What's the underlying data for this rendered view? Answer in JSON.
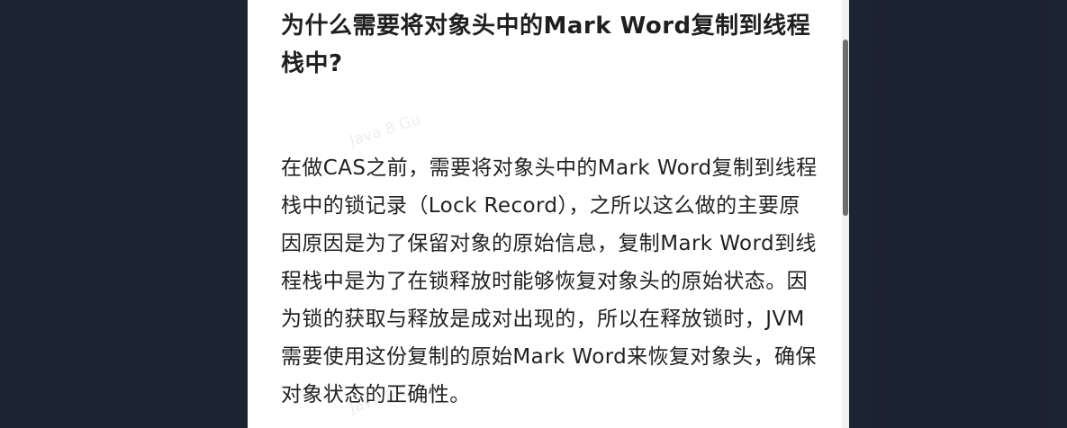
{
  "article": {
    "heading": "为什么需要将对象头中的Mark Word复制到线程栈中?",
    "body": "在做CAS之前，需要将对象头中的Mark Word复制到线程栈中的锁记录（Lock Record），之所以这么做的主要原因原因是为了保留对象的原始信息，复制Mark Word到线程栈中是为了在锁释放时能够恢复对象头的原始状态。因为锁的获取与释放是成对出现的，所以在释放锁时，JVM需要使用这份复制的原始Mark Word来恢复对象头，确保对象状态的正确性。",
    "watermark": "Java 8 Gu"
  },
  "colors": {
    "background": "#1c2331",
    "panel": "#ffffff",
    "text": "#222222",
    "scrollbar_thumb": "#6e6e6e"
  }
}
